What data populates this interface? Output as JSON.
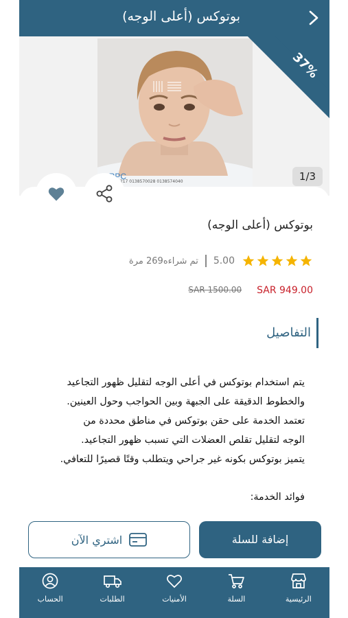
{
  "header": {
    "title": "بوتوكس (أعلى الوجه)",
    "back_icon": "chevron-right-icon"
  },
  "gallery": {
    "discount": "37%",
    "counter": "1/3",
    "contacts": "920033217  0138570028  0138574040"
  },
  "product": {
    "name": "بوتوكس (أعلى الوجه)",
    "rating_value": "5.00",
    "stars": 5,
    "sold_text": "تم شراءه269 مرة",
    "price_new": "SAR 949.00",
    "price_old": "SAR 1500.00"
  },
  "details": {
    "heading": "التفاصيل",
    "description": "يتم استخدام بوتوكس في أعلى الوجه لتقليل ظهور التجاعيد والخطوط الدقيقة على الجبهة وبين الحواجب وحول العينين. تعتمد الخدمة على حقن بوتوكس في مناطق محددة من الوجه لتقليل تقلص العضلات التي تسبب ظهور التجاعيد. يتميز بوتوكس بكونه غير جراحي ويتطلب وقتًا قصيرًا للتعافي.",
    "benefits_label": "فوائد الخدمة:"
  },
  "actions": {
    "add_to_cart": "إضافة للسلة",
    "buy_now": "اشتري الآن"
  },
  "nav": {
    "items": [
      {
        "label": "الرئيسية",
        "icon": "store-icon"
      },
      {
        "label": "السلة",
        "icon": "cart-icon"
      },
      {
        "label": "الأمنيات",
        "icon": "heart-icon"
      },
      {
        "label": "الطلبات",
        "icon": "truck-icon"
      },
      {
        "label": "الحساب",
        "icon": "user-icon"
      }
    ]
  },
  "colors": {
    "primary": "#2f6381",
    "price": "#c8202a",
    "star": "#f5b400"
  }
}
